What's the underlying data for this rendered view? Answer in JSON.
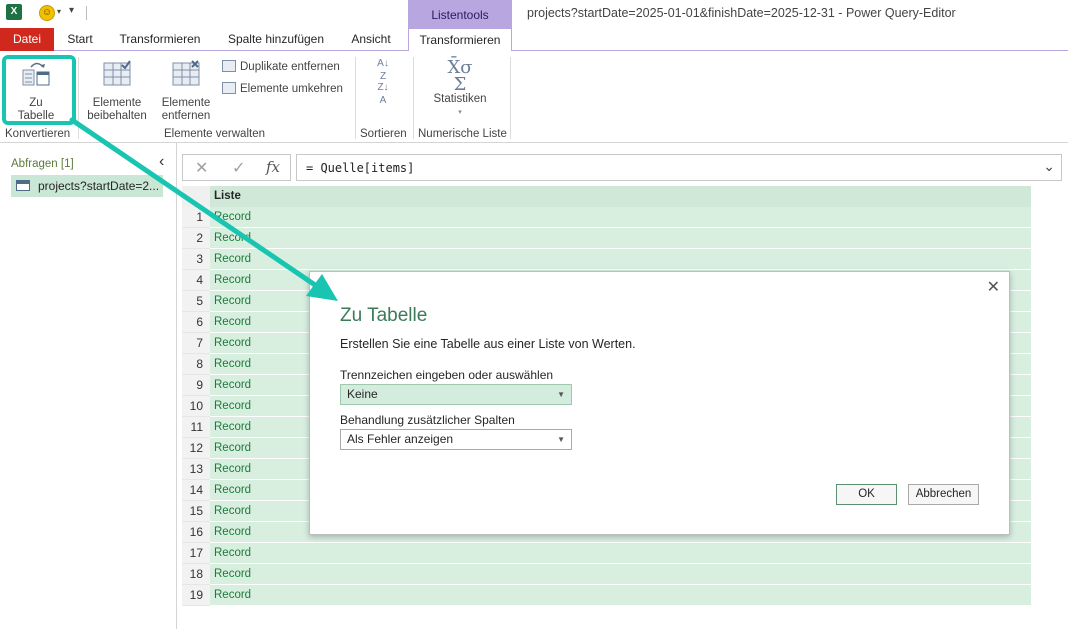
{
  "title_bar": {
    "app_icon": "excel-icon",
    "smiley_icon": "smiley-icon",
    "contextual_header": "Listentools",
    "window_title": "projects?startDate=2025-01-01&finishDate=2025-12-31 - Power Query-Editor"
  },
  "tabs": {
    "file": "Datei",
    "start": "Start",
    "transform": "Transformieren",
    "add_column": "Spalte hinzufügen",
    "view": "Ansicht",
    "list_transform": "Transformieren"
  },
  "ribbon": {
    "to_table": {
      "line1": "Zu",
      "line2": "Tabelle"
    },
    "keep_items": {
      "line1": "Elemente",
      "line2": "beibehalten"
    },
    "remove_items": {
      "line1": "Elemente",
      "line2": "entfernen"
    },
    "remove_duplicates": "Duplikate entfernen",
    "reverse_items": "Elemente umkehren",
    "statistics": "Statistiken",
    "groups": {
      "convert": "Konvertieren",
      "manage_items": "Elemente verwalten",
      "sort": "Sortieren",
      "numeric_list": "Numerische Liste"
    }
  },
  "queries_pane": {
    "title": "Abfragen [1]",
    "item": "projects?startDate=2..."
  },
  "formula_bar": {
    "fx": "fx",
    "formula": "= Quelle[items]"
  },
  "grid": {
    "column_header": "Liste",
    "rows": [
      {
        "num": "1",
        "value": "Record"
      },
      {
        "num": "2",
        "value": "Record"
      },
      {
        "num": "3",
        "value": "Record"
      },
      {
        "num": "4",
        "value": "Record"
      },
      {
        "num": "5",
        "value": "Record"
      },
      {
        "num": "6",
        "value": "Record"
      },
      {
        "num": "7",
        "value": "Record"
      },
      {
        "num": "8",
        "value": "Record"
      },
      {
        "num": "9",
        "value": "Record"
      },
      {
        "num": "10",
        "value": "Record"
      },
      {
        "num": "11",
        "value": "Record"
      },
      {
        "num": "12",
        "value": "Record"
      },
      {
        "num": "13",
        "value": "Record"
      },
      {
        "num": "14",
        "value": "Record"
      },
      {
        "num": "15",
        "value": "Record"
      },
      {
        "num": "16",
        "value": "Record"
      },
      {
        "num": "17",
        "value": "Record"
      },
      {
        "num": "18",
        "value": "Record"
      },
      {
        "num": "19",
        "value": "Record"
      }
    ]
  },
  "dialog": {
    "title": "Zu Tabelle",
    "description": "Erstellen Sie eine Tabelle aus einer Liste von Werten.",
    "delimiter_label": "Trennzeichen eingeben oder auswählen",
    "delimiter_value": "Keine",
    "extra_columns_label": "Behandlung zusätzlicher Spalten",
    "extra_columns_value": "Als Fehler anzeigen",
    "ok": "OK",
    "cancel": "Abbrechen"
  },
  "colors": {
    "accent": "#19c5b1",
    "file_tab": "#d0281c",
    "contextual": "#b7a6e0",
    "row_fill": "#d8efe0"
  }
}
